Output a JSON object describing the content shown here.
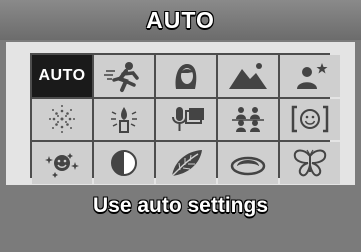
{
  "header": {
    "title": "AUTO"
  },
  "modes": {
    "selected_label": "AUTO",
    "items": [
      {
        "icon": "auto-mode"
      },
      {
        "icon": "sports-runner-icon"
      },
      {
        "icon": "portrait-icon"
      },
      {
        "icon": "landscape-icon"
      },
      {
        "icon": "night-portrait-icon"
      },
      {
        "icon": "fireworks-icon"
      },
      {
        "icon": "candlelight-icon"
      },
      {
        "icon": "voice-memo-icon"
      },
      {
        "icon": "group-photo-icon"
      },
      {
        "icon": "smile-detection-icon"
      },
      {
        "icon": "children-icon"
      },
      {
        "icon": "backlight-icon"
      },
      {
        "icon": "leaf-icon"
      },
      {
        "icon": "food-icon"
      },
      {
        "icon": "butterfly-icon"
      }
    ]
  },
  "footer": {
    "description": "Use auto settings"
  }
}
